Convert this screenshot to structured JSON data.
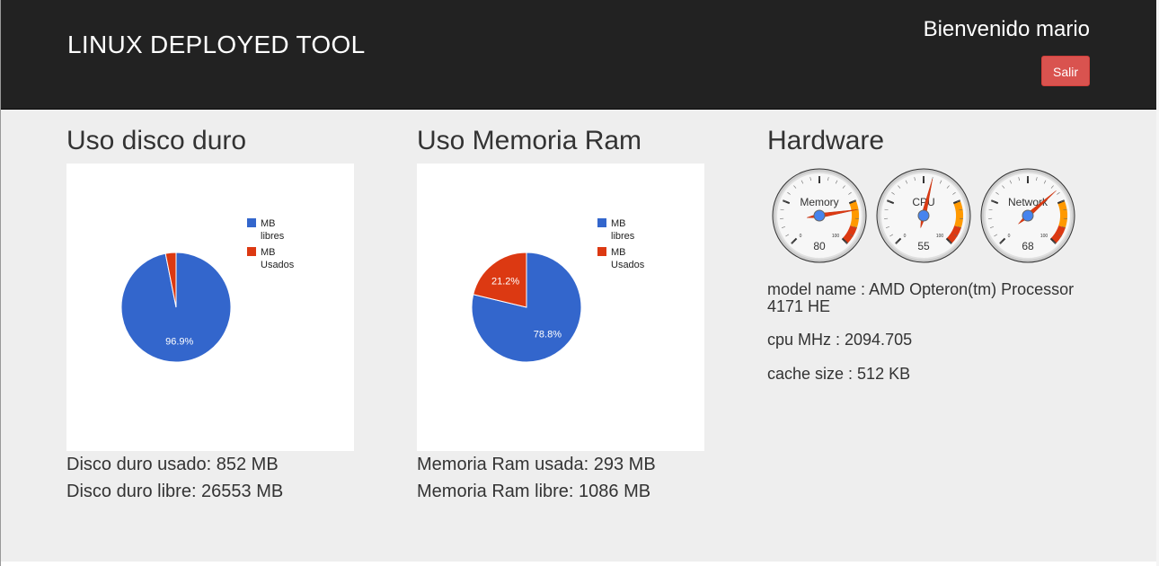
{
  "header": {
    "brand": "LINUX DEPLOYED TOOL",
    "welcome": "Bienvenido mario",
    "logout_label": "Salir",
    "logout_color": "#d9534f"
  },
  "disk": {
    "title": "Uso disco duro",
    "used_text": "Disco duro usado: 852 MB",
    "free_text": "Disco duro libre: 26553 MB",
    "chart_data": {
      "type": "pie",
      "slices": [
        {
          "legend_line1": "MB",
          "legend_line2": "libres",
          "value": 26553,
          "label": "96.9%",
          "color": "#3366cc"
        },
        {
          "legend_line1": "MB",
          "legend_line2": "Usados",
          "value": 852,
          "label": "",
          "color": "#dc3912"
        }
      ]
    }
  },
  "ram": {
    "title": "Uso Memoria Ram",
    "used_text": "Memoria Ram usada: 293 MB",
    "free_text": "Memoria Ram libre: 1086 MB",
    "chart_data": {
      "type": "pie",
      "slices": [
        {
          "legend_line1": "MB",
          "legend_line2": "libres",
          "value": 1086,
          "label": "78.8%",
          "color": "#3366cc"
        },
        {
          "legend_line1": "MB",
          "legend_line2": "Usados",
          "value": 293,
          "label": "21.2%",
          "color": "#dc3912"
        }
      ]
    }
  },
  "hardware": {
    "title": "Hardware",
    "gauges": [
      {
        "label": "Memory",
        "value": 80,
        "min": 0,
        "max": 100,
        "min_label": "0",
        "max_label": "100"
      },
      {
        "label": "CPU",
        "value": 55,
        "min": 0,
        "max": 100,
        "min_label": "0",
        "max_label": "100"
      },
      {
        "label": "Network",
        "value": 68,
        "min": 0,
        "max": 100,
        "min_label": "0",
        "max_label": "100"
      }
    ],
    "model_line": "model name : AMD Opteron(tm) Processor 4171 HE",
    "mhz_line": "cpu MHz : 2094.705",
    "cache_line": "cache size : 512 KB"
  }
}
